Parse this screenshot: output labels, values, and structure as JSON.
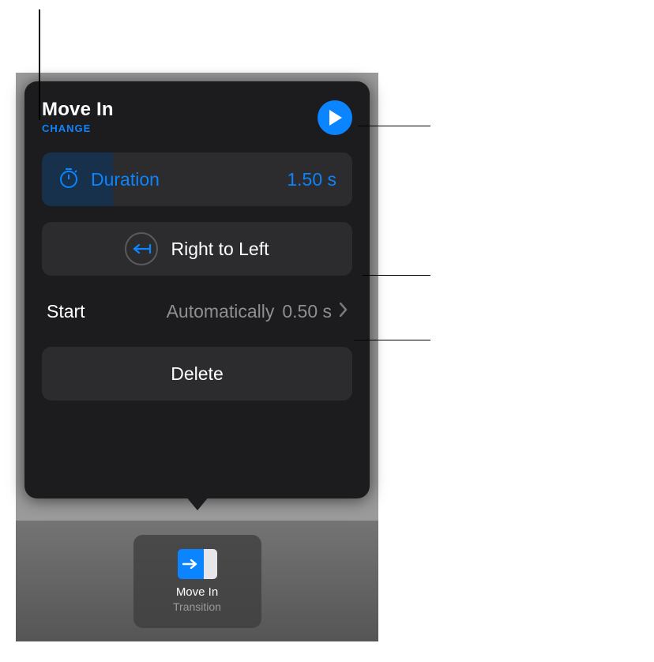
{
  "popover": {
    "title": "Move In",
    "change_label": "CHANGE",
    "duration": {
      "label": "Duration",
      "value": "1.50 s"
    },
    "direction": {
      "label": "Right to Left"
    },
    "start": {
      "label": "Start",
      "mode": "Automatically",
      "delay": "0.50 s"
    },
    "delete_label": "Delete"
  },
  "chip": {
    "name": "Move In",
    "subtitle": "Transition"
  }
}
